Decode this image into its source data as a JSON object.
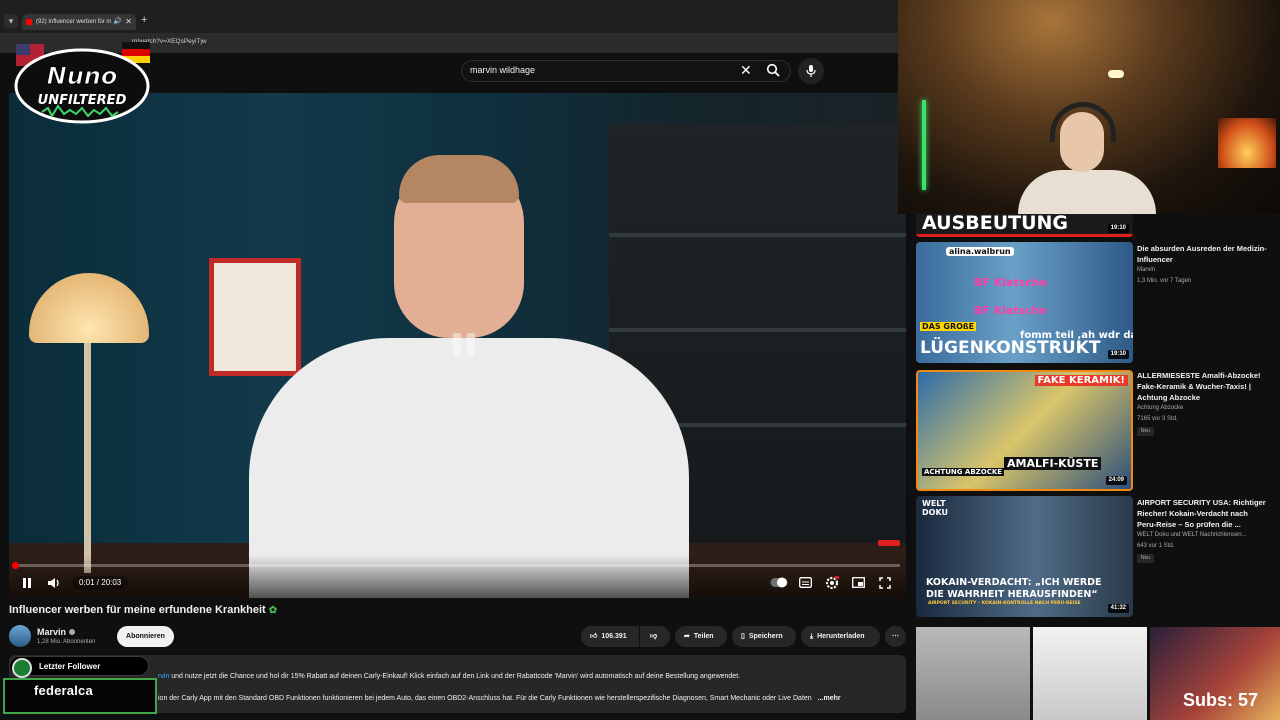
{
  "browser": {
    "tab_title": "(92) Influencer werben für m",
    "url": "m/watch?v=XEQsPeyiTjw"
  },
  "overlay": {
    "logo_line1": "Nuno",
    "logo_line2": "UNFILTERED",
    "follower_label": "Letzter Follower",
    "follower_name": "federalca",
    "subs_text": "Subs: 57"
  },
  "search": {
    "query": "marvin wildhage"
  },
  "player": {
    "time": "0:01 / 20:03",
    "progress_fraction": 0.001
  },
  "video": {
    "title": "Influencer werben für meine erfundene Krankheit",
    "channel": "Marvin",
    "subscribers": "1,28 Mio. Abonnenten",
    "subscribe_label": "Abonnieren",
    "likes": "106.391",
    "share_label": "Teilen",
    "save_label": "Speichern",
    "download_label": "Herunterladen"
  },
  "description": {
    "link_fragment": "rvin",
    "line1": " und nutze jetzt die Chance und hol dir 15% Rabatt auf deinen Carly-Einkauf! Klick einfach auf den Link und der Rabattcode 'Marvin' wird automatisch auf deine Bestellung angewendet.",
    "line2": "ion der Carly App mit den Standard OBD Funktionen funktionieren bei jedem Auto, das einen OBD2-Anschluss hat. Für die Carly Funktionen wie herstellerspezifische Diagnosen, Smart Mechanic oder Live Daten",
    "more": "...mehr"
  },
  "recommendations": [
    {
      "thumb_text": "AUSBEUTUNG",
      "duration": "19:10"
    },
    {
      "title": "Die absurden Ausreden der Medizin-Influencer",
      "channel": "Marvin",
      "meta": "1,3 Mio.  vor 7 Tagen",
      "duration": "19:10",
      "thumb_text_top": "alina.walbrun",
      "thumb_text_big": "LÜGENKONSTRUKT",
      "thumb_text_label": "DAS GROßE",
      "thumb_text_line_a": "BF Klatsche",
      "thumb_text_line_b": "BF Klatsche",
      "thumb_text_bottom": "fomm teil ,ah wdr da"
    },
    {
      "title": "ALLERMIESESTE Amalfi-Abzocke! Fake-Keramik & Wucher-Taxis! | Achtung Abzocke",
      "channel": "Achtung Abzocke",
      "meta": "7165  vor 3 Std.",
      "badge": "Neu",
      "duration": "24:09",
      "thumb_text_tag": "FAKE KERAMIK!",
      "thumb_text_place": "AMALFI-KÜSTE",
      "thumb_text_brand": "ACHTUNG ABZOCKE"
    },
    {
      "title": "AIRPORT SECURITY USA: Richtiger Riecher! Kokain-Verdacht nach Peru-Reise – So prüfen die ...",
      "channel": "WELT Doku  und WELT Nachrichtensen...",
      "meta": "643  vor 1 Std.",
      "badge": "Neu",
      "duration": "41:32",
      "thumb_text_brand_a": "WELT",
      "thumb_text_brand_b": "DOKU",
      "thumb_text_quote_a": "KOKAIN-VERDACHT: „ICH WERDE",
      "thumb_text_quote_b": "DIE WAHRHEIT HERAUSFINDEN“",
      "thumb_text_sub": "AIRPORT SECURITY – KOKAIN-KONTROLLE NACH PERU-REISE"
    }
  ],
  "icons": [
    "tab-dropdown-icon",
    "mute-icon",
    "close-icon",
    "plus-icon",
    "search-icon",
    "mic-icon",
    "pause-icon",
    "volume-icon",
    "autoplay-toggle-icon",
    "subtitles-icon",
    "settings-icon",
    "miniplayer-icon",
    "fullscreen-icon",
    "like-icon",
    "dislike-icon",
    "share-icon",
    "save-icon",
    "download-icon",
    "more-icon",
    "verified-icon"
  ]
}
